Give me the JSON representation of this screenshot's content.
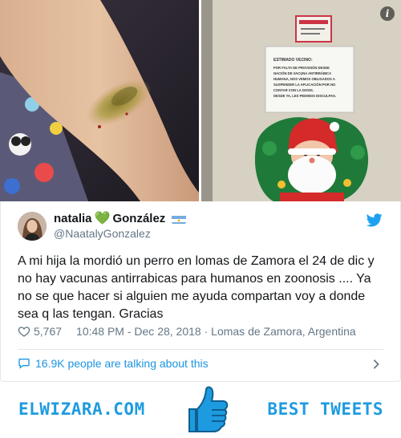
{
  "media": {
    "photo_left_alt": "arm-with-bruise-photo",
    "photo_right_alt": "door-notice-photo",
    "notice_title": "ESTIMADO VECINO:",
    "notice_lines": [
      "POR FALTA DE PROVISIÓN DESDE",
      "NACIÓN DE VACUNA ANTIRRÁBICA",
      "HUMANA, NOS VEMOS OBLIGADOS A",
      "SUSPENDER LA APLICACIÓN POR NO",
      "CONTAR CON LA DOSIS.",
      "DESDE YA, LES PEDIMOS DISCULPAS."
    ],
    "info_glyph": "i"
  },
  "tweet": {
    "display_name_first": "natalia",
    "display_name_heart": "💚",
    "display_name_last": "González",
    "handle": "@NaatalyGonzalez",
    "text": "A mi hija la mordió un perro en lomas de Zamora el 24 de dic y no hay vacunas antirrabicas para humanos en zoonosis .... Ya no se que hacer si alguien me ayuda compartan voy a donde sea q las tengan. Gracias",
    "likes": "5,767",
    "timestamp": "10:48 PM - Dec 28, 2018",
    "location_sep": " · ",
    "location": "Lomas de Zamora, Argentina",
    "talking": "16.9K people are talking about this"
  },
  "footer": {
    "brand": "ELWIZARA.COM",
    "tagline": "BEST TWEETS"
  },
  "colors": {
    "twitter_blue": "#1da1f2",
    "link_blue": "#1b95e0",
    "muted": "#657786",
    "footer_blue": "#1e9be0"
  },
  "icons": [
    "info-icon",
    "twitter-bird-icon",
    "heart-icon",
    "speech-bubble-icon",
    "chevron-right-icon",
    "thumbs-up-icon",
    "argentina-flag-icon"
  ]
}
